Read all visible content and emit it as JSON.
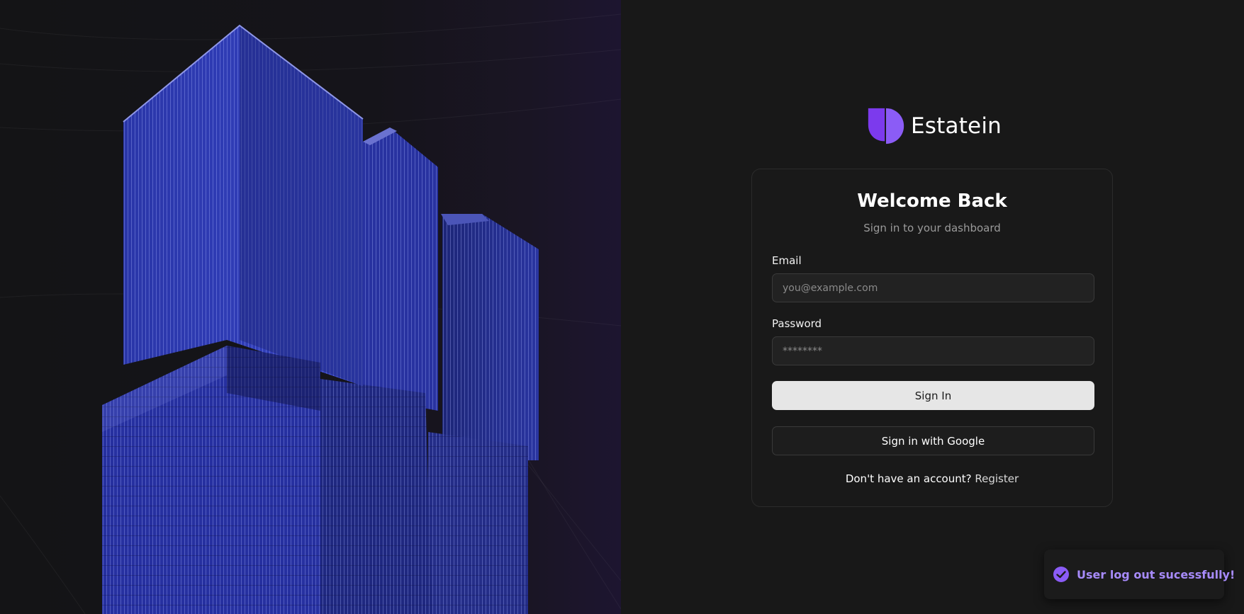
{
  "brand": {
    "name": "Estatein",
    "accent_color": "#7c3aed"
  },
  "login": {
    "title": "Welcome Back",
    "subtitle": "Sign in to your dashboard",
    "email_label": "Email",
    "email_placeholder": "you@example.com",
    "password_label": "Password",
    "password_placeholder": "********",
    "signin_label": "Sign In",
    "google_label": "Sign in with Google",
    "no_account_text": "Don't have an account?",
    "register_label": "Register"
  },
  "toast": {
    "message": "User log out sucessfully!",
    "icon": "check-circle-icon",
    "color": "#a78bfa"
  },
  "hero": {
    "image": "building-image"
  }
}
